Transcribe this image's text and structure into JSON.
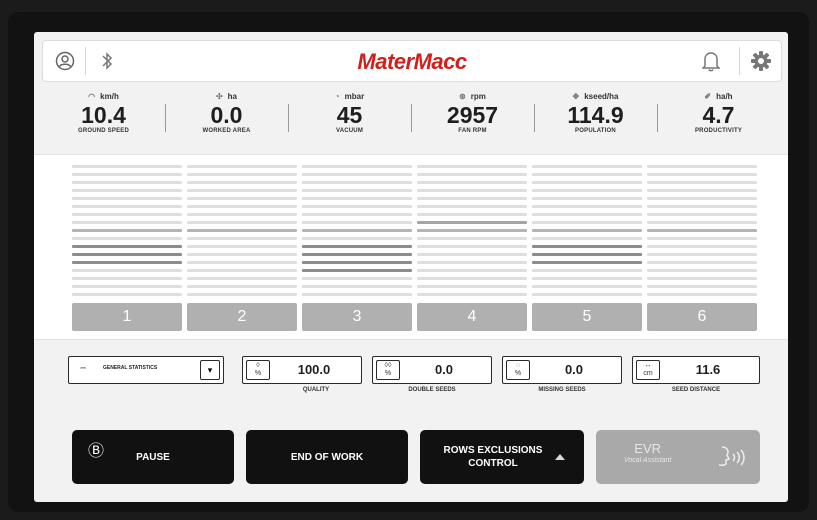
{
  "header": {
    "brand": "MaterMacc",
    "icons": [
      "user-icon",
      "bluetooth-icon",
      "bell-icon",
      "gear-icon"
    ]
  },
  "metrics": [
    {
      "icon": "speedometer-icon",
      "unit": "km/h",
      "value": "10.4",
      "label": "GROUND SPEED"
    },
    {
      "icon": "area-icon",
      "unit": "ha",
      "value": "0.0",
      "label": "WORKED AREA"
    },
    {
      "icon": "vacuum-icon",
      "unit": "mbar",
      "value": "45",
      "label": "VACUUM"
    },
    {
      "icon": "fan-icon",
      "unit": "rpm",
      "value": "2957",
      "label": "FAN RPM"
    },
    {
      "icon": "seed-icon",
      "unit": "kseed/ha",
      "value": "114.9",
      "label": "POPULATION"
    },
    {
      "icon": "productivity-icon",
      "unit": "ha/h",
      "value": "4.7",
      "label": "PRODUCTIVITY"
    }
  ],
  "rows": [
    {
      "label": "1"
    },
    {
      "label": "2"
    },
    {
      "label": "3"
    },
    {
      "label": "4"
    },
    {
      "label": "5"
    },
    {
      "label": "6"
    }
  ],
  "stats": {
    "selector": {
      "label": "GENERAL STATISTICS",
      "dropdown_glyph": "▾"
    },
    "items": [
      {
        "icon_text": "%",
        "value": "100.0",
        "label": "QUALITY"
      },
      {
        "icon_text": "%",
        "value": "0.0",
        "label": "DOUBLE SEEDS"
      },
      {
        "icon_text": "%",
        "value": "0.0",
        "label": "MISSING SEEDS"
      },
      {
        "icon_text": "cm",
        "value": "11.6",
        "label": "SEED DISTANCE"
      }
    ]
  },
  "buttons": {
    "pause": {
      "label": "PAUSE",
      "icon": "pause-circle-icon",
      "icon_glyph": "Ⓑ"
    },
    "end_of_work": {
      "label": "END OF WORK"
    },
    "rows_exclusions": {
      "label_line1": "ROWS EXCLUSIONS",
      "label_line2": "CONTROL",
      "icon": "chevron-up-icon"
    },
    "evr": {
      "title": "EVR",
      "subtitle": "Vocal Assistant",
      "icon": "voice-icon"
    }
  }
}
